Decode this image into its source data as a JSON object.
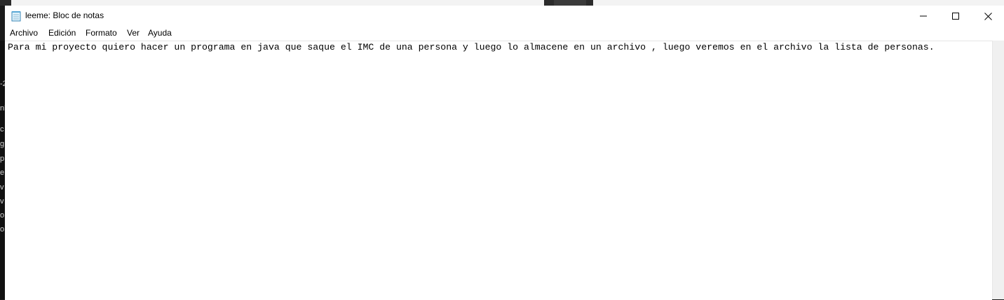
{
  "window": {
    "title": "leeme: Bloc de notas",
    "icon": "notepad-icon"
  },
  "controls": {
    "minimize_icon": "minimize-icon",
    "maximize_icon": "maximize-icon",
    "close_icon": "close-icon"
  },
  "menu": {
    "items": [
      {
        "label": "Archivo"
      },
      {
        "label": "Edición"
      },
      {
        "label": "Formato"
      },
      {
        "label": "Ver"
      },
      {
        "label": "Ayuda"
      }
    ]
  },
  "editor": {
    "content": "Para mi proyecto quiero hacer un programa en java que saque el IMC de una persona y luego lo almacene en un archivo , luego veremos en el archivo la lista de personas."
  },
  "background_window": {
    "edge_letters": [
      "-2",
      "nl",
      "c",
      "g",
      "p",
      "e",
      "v",
      "v",
      "o",
      "o"
    ]
  }
}
